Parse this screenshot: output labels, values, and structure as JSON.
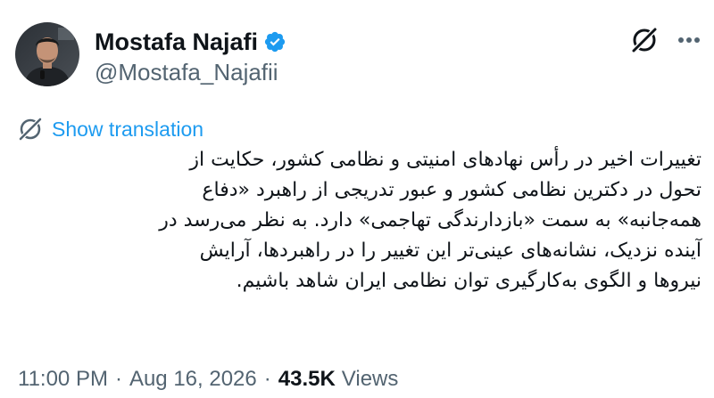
{
  "author": {
    "display_name": "Mostafa Najafi",
    "handle": "@Mostafa_Najafii",
    "verified": true
  },
  "actions": {
    "grok_icon": "grok-icon",
    "more_icon": "more-icon"
  },
  "translation": {
    "label": "Show translation",
    "icon": "globe-icon"
  },
  "tweet": {
    "lines": [
      "تغییرات اخیر در رأس نهادهای امنیتی و نظامی کشور، حکایت از",
      "تحول در دکترین نظامی کشور و عبور تدریجی از راهبرد «دفاع",
      "همه‌جانبه» به سمت «بازدارندگی تهاجمی» دارد. به نظر می‌رسد در",
      "آینده نزدیک، نشانه‌های عینی‌تر این تغییر را در راهبردها، آرایش",
      "نیروها و الگوی به‌کارگیری توان نظامی ایران شاهد باشیم."
    ]
  },
  "meta": {
    "time": "11:00 PM",
    "separator": "·",
    "date": "Aug 16, 2026",
    "views_count": "43.5K",
    "views_label": "Views"
  },
  "colors": {
    "text": "#0f1419",
    "secondary": "#536471",
    "accent": "#1d9bf0"
  }
}
